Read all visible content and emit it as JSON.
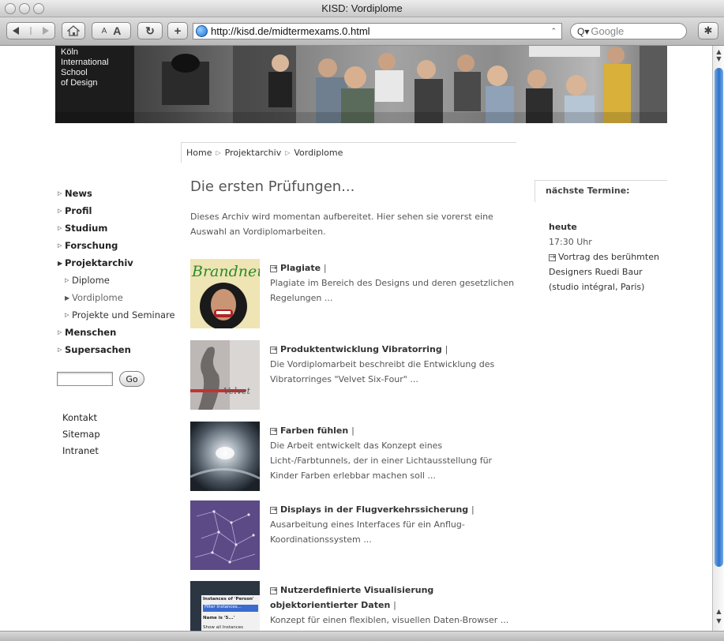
{
  "window": {
    "title": "KISD: Vordiplome"
  },
  "toolbar": {
    "text_smaller": "A",
    "text_bigger": "A",
    "url": "http://kisd.de/midtermexams.0.html",
    "search_placeholder": "Google"
  },
  "brand": {
    "logo_line1": "Köln",
    "logo_line2": "International",
    "logo_line3": "School",
    "logo_line4": "of Design"
  },
  "breadcrumb": [
    "Home",
    "Projektarchiv",
    "Vordiplome"
  ],
  "nav": {
    "items": [
      {
        "label": "News"
      },
      {
        "label": "Profil"
      },
      {
        "label": "Studium"
      },
      {
        "label": "Forschung"
      },
      {
        "label": "Projektarchiv"
      },
      {
        "label": "Diplome"
      },
      {
        "label": "Vordiplome"
      },
      {
        "label": "Projekte und Seminare"
      },
      {
        "label": "Menschen"
      },
      {
        "label": "Supersachen"
      }
    ],
    "search_button": "Go",
    "footer_links": [
      "Kontakt",
      "Sitemap",
      "Intranet"
    ]
  },
  "main": {
    "title": "Die ersten Prüfungen...",
    "intro": "Dieses Archiv wird momentan aufbereitet. Hier sehen sie vorerst eine Auswahl an Vordiplomarbeiten.",
    "articles": [
      {
        "title": "Plagiate",
        "desc": "Plagiate im Bereich des Designs und deren gesetzlichen Regelungen ...",
        "thumb_text": "Brandneu"
      },
      {
        "title": "Produktentwicklung Vibratorring",
        "desc": "Die Vordiplomarbeit beschreibt die Entwicklung des Vibratorringes \"Velvet Six-Four\" ...",
        "thumb_text": "Velvet"
      },
      {
        "title": "Farben fühlen",
        "desc": "Die Arbeit entwickelt das Konzept eines Licht-/Farbtunnels, der in einer Lichtausstellung für Kinder Farben erlebbar machen soll ..."
      },
      {
        "title": "Displays in der Flugverkehrssicherung",
        "desc": "Ausarbeitung eines Interfaces für ein Anflug-Koordinationssystem ..."
      },
      {
        "title": "Nutzerdefinierte Visualisierung objektorientierter Daten",
        "desc": "Konzept für einen flexiblen, visuellen Daten-Browser ...",
        "thumb_lines": [
          "Instances of 'Person'",
          "Filter Instances...",
          "Name is '5...'",
          "Show all Instances"
        ]
      }
    ]
  },
  "sidebar": {
    "heading": "nächste Termine:",
    "day": "heute",
    "time": "17:30 Uhr",
    "event": "Vortrag des berühmten Designers Ruedi Baur (studio intégral, Paris)"
  },
  "colors": {
    "accent_scroll": "#2f73c8",
    "text": "#333333",
    "muted": "#555555"
  }
}
